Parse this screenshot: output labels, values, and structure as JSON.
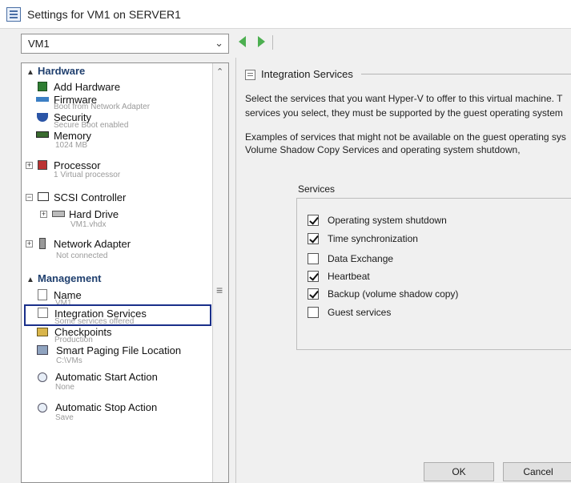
{
  "window": {
    "title": "Settings for VM1 on SERVER1"
  },
  "vm_selector": {
    "value": "VM1"
  },
  "tree": {
    "hardware_header": "Hardware",
    "management_header": "Management",
    "hardware": [
      {
        "label": "Add Hardware",
        "sub": ""
      },
      {
        "label": "Firmware",
        "sub": "Boot from Network Adapter"
      },
      {
        "label": "Security",
        "sub": "Secure Boot enabled"
      },
      {
        "label": "Memory",
        "sub": "1024 MB"
      },
      {
        "label": "Processor",
        "sub": "1 Virtual processor"
      },
      {
        "label": "SCSI Controller",
        "sub": ""
      },
      {
        "label": "Hard Drive",
        "sub": "VM1.vhdx"
      },
      {
        "label": "Network Adapter",
        "sub": "Not connected"
      }
    ],
    "management": [
      {
        "label": "Name",
        "sub": "VM1"
      },
      {
        "label": "Integration Services",
        "sub": "Some services offered"
      },
      {
        "label": "Checkpoints",
        "sub": "Production"
      },
      {
        "label": "Smart Paging File Location",
        "sub": "C:\\VMs"
      },
      {
        "label": "Automatic Start Action",
        "sub": "None"
      },
      {
        "label": "Automatic Stop Action",
        "sub": "Save"
      }
    ]
  },
  "content": {
    "header": "Integration Services",
    "para1_line1": "Select the services that you want Hyper-V to offer to this virtual machine. T",
    "para1_line2": "services you select, they must be supported by the guest operating system",
    "para2_line1": "Examples of services that might not be available on the guest operating sys",
    "para2_line2": "Volume Shadow Copy Services and operating system shutdown,",
    "services_title": "Services",
    "services": [
      {
        "label": "Operating system shutdown",
        "checked": true
      },
      {
        "label": "Time synchronization",
        "checked": true
      },
      {
        "label": "Data Exchange",
        "checked": false
      },
      {
        "label": "Heartbeat",
        "checked": true
      },
      {
        "label": "Backup (volume shadow copy)",
        "checked": true
      },
      {
        "label": "Guest services",
        "checked": false
      }
    ]
  },
  "buttons": {
    "ok": "OK",
    "cancel": "Cancel"
  },
  "icons": {
    "title": "settings-icon",
    "back": "back-arrow-icon",
    "forward": "forward-arrow-icon"
  },
  "colors": {
    "accent_green": "#4caf50",
    "section_header": "#1f3f6e",
    "selection_border": "#1a2f8a"
  }
}
